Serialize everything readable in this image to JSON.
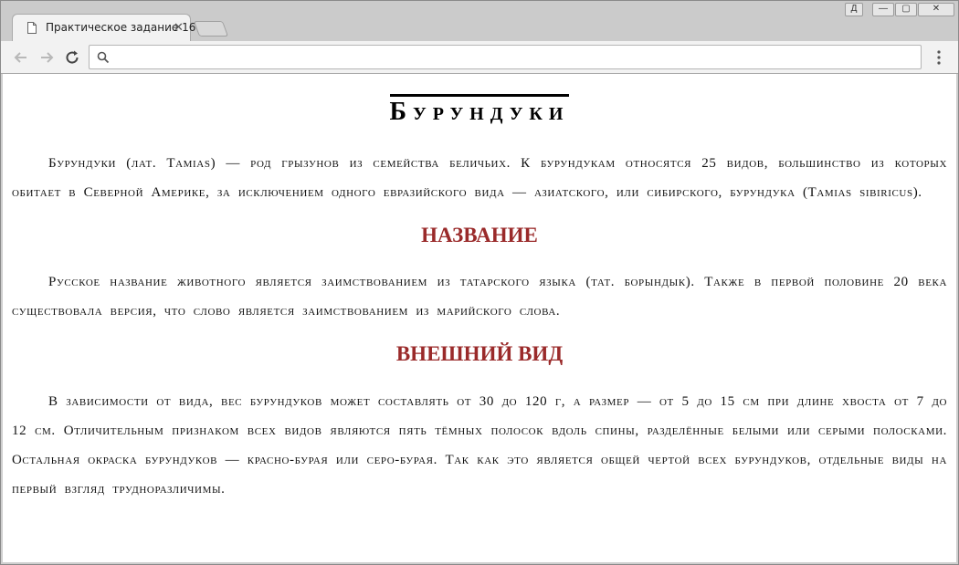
{
  "browser": {
    "tab_title": "Практическое задание 16",
    "tab_close": "✕",
    "user_btn": "Д",
    "min_btn": "—",
    "max_btn": "▢",
    "close_btn": "✕",
    "address_value": "",
    "icons": [
      "page-icon",
      "back-arrow-icon",
      "forward-arrow-icon",
      "reload-icon",
      "search-icon",
      "menu-dots-icon"
    ]
  },
  "article": {
    "title": "Бурундуки",
    "intro": "Бурундуки (лат. Tamias) — род грызунов из семейства беличьих. К бурундукам относятся 25 видов, большинство из которых обитает в Северной Америке, за исключением одного евразийского вида — азиатского, или сибирского, бурундука (Tamias sibiricus).",
    "section1_heading": "НАЗВАНИЕ",
    "section1_text": "Русское название животного является заимствованием из татарского языка (тат. борындык). Также в первой половине 20 века существовала версия, что слово является заимствованием из марийского слова.",
    "section2_heading": "ВНЕШНИЙ ВИД",
    "section2_text": "В зависимости от вида, вес бурундуков может составлять от 30 до 120 г, а размер — от 5 до 15 см при длине хвоста от 7 до 12 см. Отличительным признаком всех видов являются пять тёмных полосок вдоль спины, разделённые белыми или серыми полосками. Остальная окраска бурундуков — красно-бурая или серо-бурая. Так как это является общей чертой всех бурундуков, отдельные виды на первый взгляд трудноразличимы."
  },
  "colors": {
    "heading_red": "#9a2a2a",
    "text": "#111111",
    "window_frame": "#cbcbcb"
  }
}
